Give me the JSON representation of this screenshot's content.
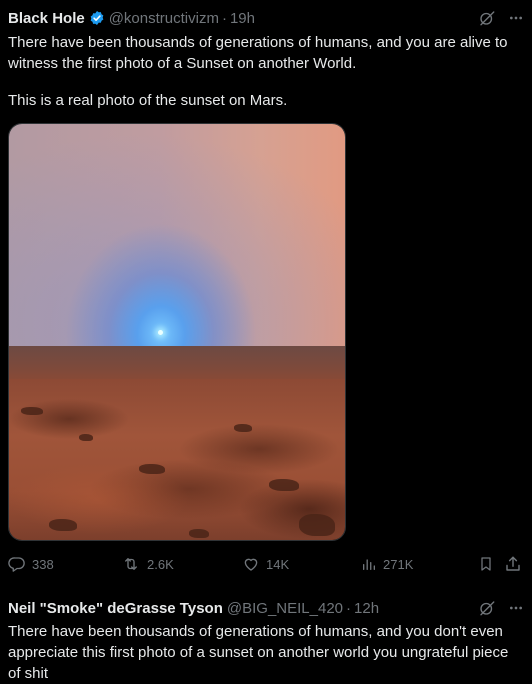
{
  "tweet1": {
    "display_name": "Black Hole",
    "handle": "@konstructivizm",
    "separator": "·",
    "time": "19h",
    "text_para1": "There have been thousands of generations of humans, and you are alive to witness the first photo of a Sunset on another World.",
    "text_para2": "This is a real photo of the sunset on Mars.",
    "media_icon": "photo-mars-sunset",
    "actions": {
      "replies": "338",
      "reposts": "2.6K",
      "likes": "14K",
      "views": "271K"
    },
    "icons": {
      "verified": "verified-badge-icon",
      "grok": "grok-icon",
      "more": "more-icon",
      "reply": "reply-icon",
      "repost": "repost-icon",
      "like": "like-icon",
      "views": "views-icon",
      "bookmark": "bookmark-icon",
      "share": "share-icon"
    },
    "colors": {
      "verified": "#1d9bf0",
      "muted": "#71767b",
      "text": "#e7e9ea",
      "background": "#000000"
    }
  },
  "tweet2": {
    "display_name": "Neil \"Smoke\" deGrasse Tyson",
    "handle": "@BIG_NEIL_420",
    "separator": "·",
    "time": "12h",
    "text": "There have been thousands of generations of humans, and you don't even appreciate this first photo of a sunset on another world you ungrateful piece of shit"
  }
}
